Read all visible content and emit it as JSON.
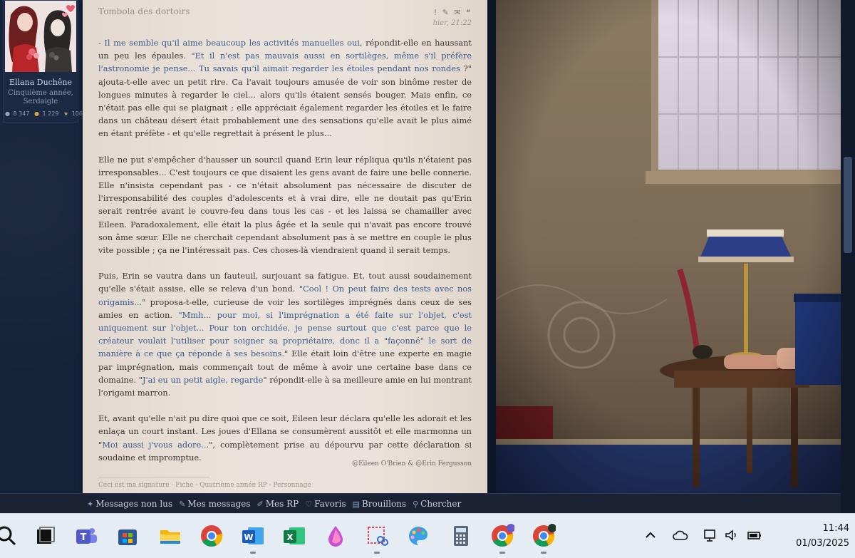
{
  "profile": {
    "name": "Ellana Duchêne",
    "house_line1": "Cinquième année,",
    "house_line2": "Serdaigle",
    "stats": {
      "messages": "8 347",
      "points": "1 229",
      "stars": "1067"
    }
  },
  "post": {
    "title": "Tombola des dortoirs",
    "date": "hier, 21:22",
    "tools": [
      "report-icon",
      "edit-icon",
      "mail-icon",
      "quote-icon"
    ],
    "paragraphs": [
      [
        {
          "t": "- Il me semble qu'il aime beaucoup les activités manuelles oui",
          "speech": true
        },
        {
          "t": ", répondit-elle en haussant un peu les épaules. ",
          "speech": false
        },
        {
          "t": "\"Et il n'est pas mauvais aussi en sortilèges, même s'il préfère l'astronomie je pense... Tu savais qu'il aimait regarder les étoiles pendant nos rondes",
          "speech": true
        },
        {
          "t": " ?\" ajouta-t-elle avec un petit rire. Ca l'avait toujours amusée de voir son binôme rester de longues minutes à regarder le ciel... alors qu'ils étaient sensés bouger. Mais enfin, ce n'était pas elle qui se plaignait ; elle appréciait également regarder les étoiles et le faire dans un château désert était probablement une des sensations qu'elle avait le plus aimé en étant préfète - et qu'elle regrettait à présent le plus...",
          "speech": false
        }
      ],
      [
        {
          "t": "Elle ne put s'empêcher d'hausser un sourcil quand Erin leur répliqua qu'ils n'étaient pas irresponsables... C'est toujours ce que disaient les gens avant de faire une belle connerie. Elle n'insista cependant pas - ce n'était absolument pas nécessaire de discuter de l'irresponsabilité des couples d'adolescents et à vrai dire, elle ne doutait pas qu'Erin serait rentrée avant le couvre-feu dans tous les cas - et les laissa se chamailler avec Eileen. Paradoxalement, elle était la plus âgée et la seule qui n'avait pas encore trouvé son âme sœur. Elle ne cherchait cependant absolument pas à se mettre en couple le plus vite possible ; ça ne l'intéressait pas. Ces choses-là viendraient quand il serait temps.",
          "speech": false
        }
      ],
      [
        {
          "t": "Puis, Erin se vautra dans un fauteuil, surjouant sa fatigue. Et, tout aussi soudainement qu'elle s'était assise, elle se releva d'un bond. ",
          "speech": false
        },
        {
          "t": "\"Cool ! On peut faire des tests avec nos origamis...",
          "speech": true
        },
        {
          "t": "\" proposa-t-elle, curieuse de voir les sortilèges imprégnés dans ceux de ses amies en action. ",
          "speech": false
        },
        {
          "t": "\"Mmh... pour moi, si l'imprégnation a été faite sur l'objet, c'est uniquement sur l'objet... Pour ton orchidée, je pense surtout que c'est parce que le créateur voulait l'utiliser pour soigner sa propriétaire, donc il a \"façonné\" le sort de manière à ce que ça réponde à ses besoins.",
          "speech": true
        },
        {
          "t": "\" Elle était loin d'être une experte en magie par imprégnation, mais commençait tout de même à avoir une certaine base dans ce domaine. \"",
          "speech": false
        },
        {
          "t": "J'ai eu un petit aigle, regarde",
          "speech": true
        },
        {
          "t": "\" répondit-elle à sa meilleure amie en lui montrant l'origami marron.",
          "speech": false
        }
      ],
      [
        {
          "t": "Et, avant qu'elle n'ait pu dire quoi que ce soit, Eileen leur déclara qu'elle les adorait et les enlaça un court instant. Les joues d'Ellana se consumèrent aussitôt et elle marmonna un \"",
          "speech": false
        },
        {
          "t": "Moi aussi j'vous adore...",
          "speech": true
        },
        {
          "t": "\", complètement prise au dépourvu par cette déclaration si soudaine et impromptue.",
          "speech": false
        }
      ]
    ],
    "tags": "@Eileen O'Brien & @Erin Fergusson",
    "signature_fragment": "Ceci est ma signature · Fiche · Quatrième année RP · Personnage"
  },
  "navbar": {
    "items": [
      {
        "label": "Messages non lus",
        "icon": "sparkle-icon"
      },
      {
        "label": "Mes messages",
        "icon": "pencil-icon"
      },
      {
        "label": "Mes RP",
        "icon": "feather-icon"
      },
      {
        "label": "Favoris",
        "icon": "heart-icon"
      },
      {
        "label": "Brouillons",
        "icon": "drafts-icon"
      },
      {
        "label": "Chercher",
        "icon": "search-icon"
      }
    ]
  },
  "taskbar": {
    "apps": [
      "search-icon",
      "task-view-icon",
      "teams-icon",
      "store-icon",
      "file-explorer-icon",
      "chrome-icon",
      "word-icon",
      "excel-icon",
      "paint-icon",
      "snipping-tool-icon",
      "paint-palette-icon",
      "calculator-icon",
      "chrome-profile-icon",
      "chrome-profile-2-icon"
    ],
    "tray_icons": [
      "chevron-up-icon",
      "onedrive-icon",
      "network-icon",
      "volume-icon",
      "battery-icon"
    ],
    "time": "11:44",
    "date": "01/03/2025"
  },
  "colors": {
    "speech": "#3a5a8a",
    "body_text": "#3a3330",
    "post_bg": "#ebe3db",
    "dark_bg": "#15233a"
  }
}
